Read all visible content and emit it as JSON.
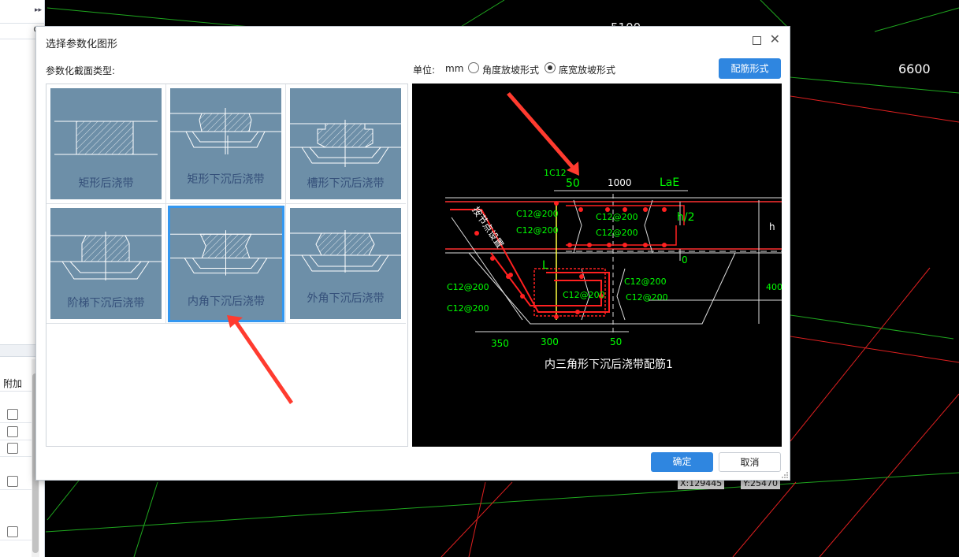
{
  "canvas": {
    "dim_labels": [
      "5100",
      "6600"
    ],
    "coords": [
      "X:129445",
      "Y:25470"
    ]
  },
  "left_panel": {
    "column_header": "附加",
    "checkbox_rows": [
      false,
      false,
      false,
      false,
      false
    ]
  },
  "dialog": {
    "title": "选择参数化图形",
    "section_label": "参数化截面类型:",
    "unit_label": "单位:",
    "unit_value": "mm",
    "radio_angle": "角度放坡形式",
    "radio_width": "底宽放坡形式",
    "selected_radio": "底宽放坡形式",
    "rebar_button": "配筋形式",
    "ok_button": "确定",
    "cancel_button": "取消",
    "tiles": [
      {
        "label": "矩形后浇带"
      },
      {
        "label": "矩形下沉后浇带"
      },
      {
        "label": "槽形下沉后浇带"
      },
      {
        "label": "阶梯下沉后浇带"
      },
      {
        "label": "内角下沉后浇带",
        "selected": true
      },
      {
        "label": "外角下沉后浇带"
      }
    ],
    "preview": {
      "caption": "内三角形下沉后浇带配筋1",
      "labels": {
        "top_bar": "1C12",
        "d50a": "50",
        "d1000": "1000",
        "lae": "LaE",
        "h_half": "h/2",
        "h": "h",
        "zero": "0",
        "d400": "400",
        "L": "L",
        "d350": "350",
        "d300": "300",
        "d50b": "50",
        "slope_text": "按节点设置"
      },
      "rebar_left": [
        "C12@200",
        "C12@200",
        "C12@200",
        "C12@200"
      ],
      "rebar_right": [
        "C12@200",
        "C12@200",
        "C12@200",
        "C12@200",
        "C12@200"
      ]
    },
    "colors": {
      "accent": "#2f86e0",
      "tile_bg": "#6d8fa8",
      "selected_border": "#3397f0",
      "rebar": "#ff2020",
      "dim_text": "#00ff00",
      "annotation_arrow": "#ff3b2f"
    }
  }
}
